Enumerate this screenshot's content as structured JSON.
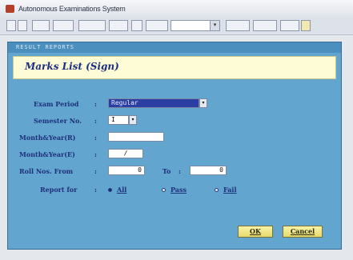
{
  "window": {
    "title": "Autonomous Examinations System"
  },
  "toolbar": {
    "combo_value": "",
    "combo_drop": "▾"
  },
  "panel": {
    "header": "RESULT REPORTS",
    "banner_title": "Marks List (Sign)"
  },
  "form": {
    "exam_period": {
      "label": "Exam Period",
      "value": "Regular"
    },
    "semester": {
      "label": "Semester No.",
      "value": "I"
    },
    "month_year_r": {
      "label": "Month&Year(R)",
      "value": ""
    },
    "month_year_e": {
      "label": "Month&Year(E)",
      "value": "/"
    },
    "roll_from": {
      "label": "Roll Nos. From",
      "value": "0"
    },
    "roll_to": {
      "label": "To",
      "value": "0"
    },
    "report_for": {
      "label": "Report for",
      "options": [
        "All",
        "Pass",
        "Fail"
      ],
      "selected": "All"
    },
    "colon": ":",
    "drop_glyph": "▾"
  },
  "buttons": {
    "ok": "OK",
    "cancel": "Cancel"
  }
}
